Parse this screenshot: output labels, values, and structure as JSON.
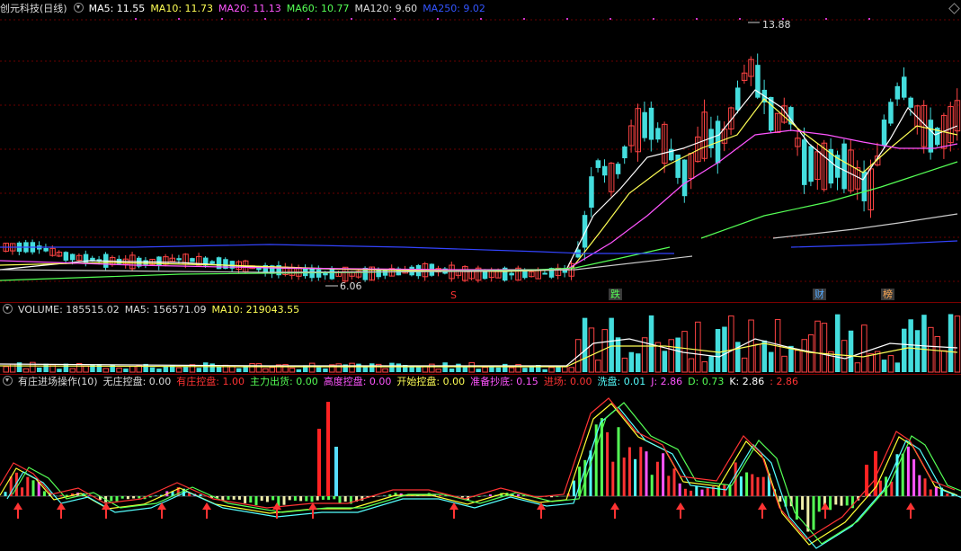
{
  "main": {
    "title": "创元科技(日线)",
    "indicators": [
      {
        "label": "MA5: 11.55",
        "color": "#ffffff"
      },
      {
        "label": "MA10: 11.73",
        "color": "#ffff55"
      },
      {
        "label": "MA20: 11.13",
        "color": "#ff55ff"
      },
      {
        "label": "MA60: 10.77",
        "color": "#55ff55"
      },
      {
        "label": "MA120: 9.60",
        "color": "#dddddd"
      },
      {
        "label": "MA250: 9.02",
        "color": "#3355ff"
      }
    ],
    "high_label": "13.88",
    "low_label": "6.06",
    "markers": [
      {
        "text": "S",
        "color": "#ff3333"
      },
      {
        "text": "跌",
        "color": "#55ff55"
      },
      {
        "text": "财",
        "color": "#55aaff"
      },
      {
        "text": "榜",
        "color": "#ffaa55"
      }
    ]
  },
  "volume": {
    "indicators": [
      {
        "label": "VOLUME: 185515.02",
        "color": "#dddddd"
      },
      {
        "label": "MA5: 156571.09",
        "color": "#dddddd"
      },
      {
        "label": "MA10: 219043.55",
        "color": "#ffff55"
      }
    ]
  },
  "indicator": {
    "title": "有庄进场操作(10)",
    "items": [
      {
        "label": "无庄控盘: 0.00",
        "color": "#dddddd"
      },
      {
        "label": "有庄控盘: 1.00",
        "color": "#ff3333"
      },
      {
        "label": "主力出货: 0.00",
        "color": "#55ff55"
      },
      {
        "label": "高度控盘: 0.00",
        "color": "#ff55ff"
      },
      {
        "label": "开始控盘: 0.00",
        "color": "#ffff55"
      },
      {
        "label": "准备抄底: 0.15",
        "color": "#ff55ff"
      },
      {
        "label": "进场: 0.00",
        "color": "#ff3333"
      },
      {
        "label": "洗盘: 0.01",
        "color": "#55ffff"
      },
      {
        "label": "J: 2.86",
        "color": "#ff55ff"
      },
      {
        "label": "D: 0.73",
        "color": "#55ff55"
      },
      {
        "label": "K: 2.86",
        "color": "#ffffff"
      },
      {
        "label": ": 2.86",
        "color": "#ff3333"
      }
    ]
  }
}
